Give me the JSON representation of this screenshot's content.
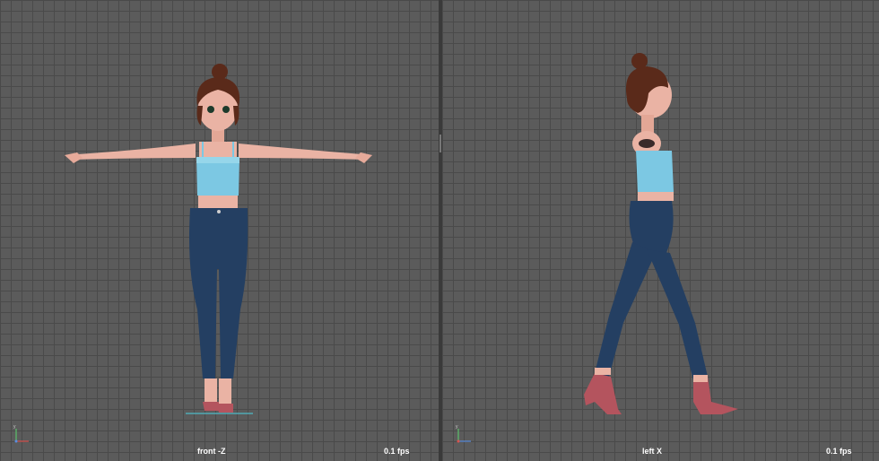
{
  "viewports": {
    "front": {
      "camera_label": "front -Z",
      "fps_label": "0.1 fps"
    },
    "left": {
      "camera_label": "left X",
      "fps_label": "0.1 fps"
    }
  },
  "colors": {
    "grid_bg": "#5b5b5b",
    "grid_line": "#4a4a4a",
    "skin": "#eab3a4",
    "hair": "#5a2a1a",
    "top": "#7cc8e3",
    "jeans": "#243f62",
    "shoes": "#b4545e"
  },
  "icons": {
    "front_axis": "axis-gizmo-icon",
    "left_axis": "axis-gizmo-icon"
  }
}
